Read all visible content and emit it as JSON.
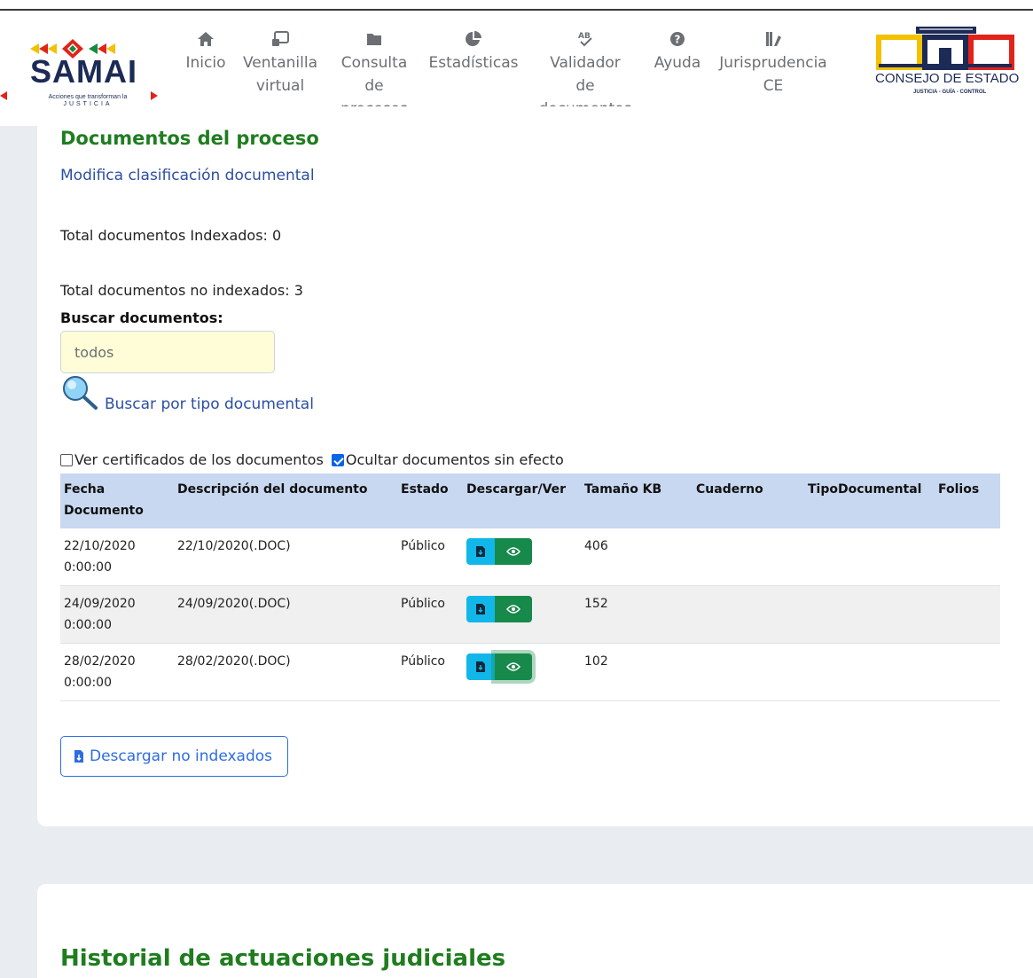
{
  "header": {
    "logo": {
      "name": "SAMAI",
      "tagline": "Acciones que transforman la",
      "tagline2": "JUSTICIA"
    },
    "nav": [
      {
        "label_lines": [
          "Inicio"
        ],
        "icon": "home-icon"
      },
      {
        "label_lines": [
          "Ventanilla",
          "virtual"
        ],
        "icon": "window-icon"
      },
      {
        "label_lines": [
          "Consulta",
          "de",
          "procesos"
        ],
        "icon": "folder-icon"
      },
      {
        "label_lines": [
          "Estadísticas"
        ],
        "icon": "pie-chart-icon"
      },
      {
        "label_lines": [
          "Validador",
          "de",
          "documentos"
        ],
        "icon": "spellcheck-icon"
      },
      {
        "label_lines": [
          "Ayuda"
        ],
        "icon": "question-icon"
      },
      {
        "label_lines": [
          "Jurisprudencia",
          "CE"
        ],
        "icon": "law-book-icon"
      }
    ],
    "right_logo": {
      "title": "CONSEJO DE ESTADO",
      "subtitle": "JUSTICIA - GUÍA - CONTROL"
    }
  },
  "documents": {
    "heading": "Documentos del proceso",
    "modify_link": "Modifica clasificación documental",
    "total_indexed": "Total documentos Indexados: 0",
    "total_not_indexed": "Total documentos no indexados: 3",
    "search_label": "Buscar documentos:",
    "search_placeholder": "todos",
    "search_type_link": "Buscar por tipo documental",
    "check_certificates": "Ver certificados de los documentos",
    "check_hide": "Ocultar documentos sin efecto",
    "check_certificates_checked": false,
    "check_hide_checked": true,
    "columns": {
      "fecha_1": "Fecha",
      "fecha_2": "Documento",
      "descripcion": "Descripción del documento",
      "estado": "Estado",
      "descargar": "Descargar/Ver",
      "tamano": "Tamaño KB",
      "cuaderno": "Cuaderno",
      "tipo": "TipoDocumental",
      "folios": "Folios"
    },
    "rows": [
      {
        "fecha": "22/10/2020",
        "hora": "0:00:00",
        "descripcion": "22/10/2020(.DOC)",
        "estado": "Público",
        "tamano": "406",
        "cuaderno": "",
        "tipo": "",
        "folios": ""
      },
      {
        "fecha": "24/09/2020",
        "hora": "0:00:00",
        "descripcion": "24/09/2020(.DOC)",
        "estado": "Público",
        "tamano": "152",
        "cuaderno": "",
        "tipo": "",
        "folios": ""
      },
      {
        "fecha": "28/02/2020",
        "hora": "0:00:00",
        "descripcion": "28/02/2020(.DOC)",
        "estado": "Público",
        "tamano": "102",
        "cuaderno": "",
        "tipo": "",
        "folios": ""
      }
    ],
    "download_button": "Descargar no indexados"
  },
  "history": {
    "heading": "Historial de actuaciones judiciales"
  },
  "colors": {
    "green_heading": "#1f7d1f",
    "link_blue": "#2b4ea2",
    "table_header": "#c8d8f0",
    "download_btn": "#11b7e8",
    "view_btn": "#17894a"
  }
}
